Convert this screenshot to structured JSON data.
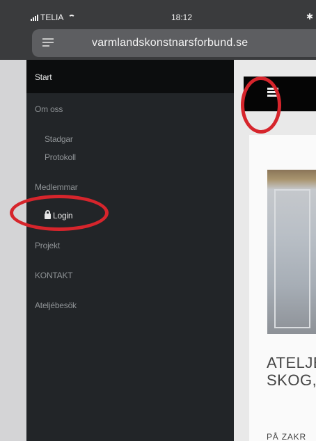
{
  "status_bar": {
    "carrier": "TELIA",
    "time": "18:12",
    "bluetooth_symbol": "✱"
  },
  "url_bar": {
    "url": "varmlandskonstnarsforbund.se",
    "reader_icon": "reader-view-icon"
  },
  "nav": {
    "items": [
      {
        "label": "Start",
        "active": true
      },
      {
        "label": "Om oss"
      },
      {
        "label": "Stadgar"
      },
      {
        "label": "Protokoll"
      },
      {
        "label": "Medlemmar"
      },
      {
        "label": "Login",
        "icon": "lock-icon"
      },
      {
        "label": "Projekt"
      },
      {
        "label": "KONTAKT"
      },
      {
        "label": "Ateljébesök"
      }
    ]
  },
  "content": {
    "menu_icon": "hamburger-icon",
    "card_title": "ATELJÉ\nSKOG,",
    "card_sub": "PÅ ZAKR"
  },
  "annotations": {
    "color": "#d6252c"
  }
}
